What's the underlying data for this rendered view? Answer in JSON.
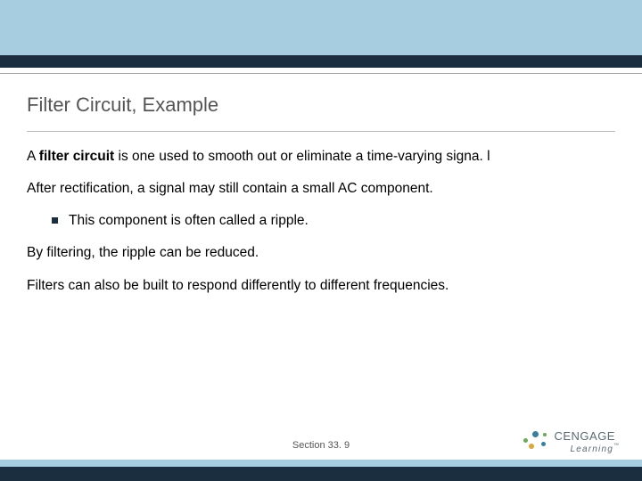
{
  "title": "Filter Circuit, Example",
  "paragraphs": {
    "p1_prefix": "A ",
    "p1_bold": "filter circuit",
    "p1_suffix": " is one used to smooth out or eliminate a time-varying signa. l",
    "p2": "After rectification, a signal may still contain a small AC component.",
    "bullet1": "This component is often called a ripple.",
    "p3": "By filtering, the ripple can be reduced.",
    "p4": "Filters can also be built to respond differently to different frequencies."
  },
  "footer": {
    "section": "Section  33. 9",
    "brand_main": "CENGAGE",
    "brand_sub": "Learning",
    "tm": "™"
  }
}
